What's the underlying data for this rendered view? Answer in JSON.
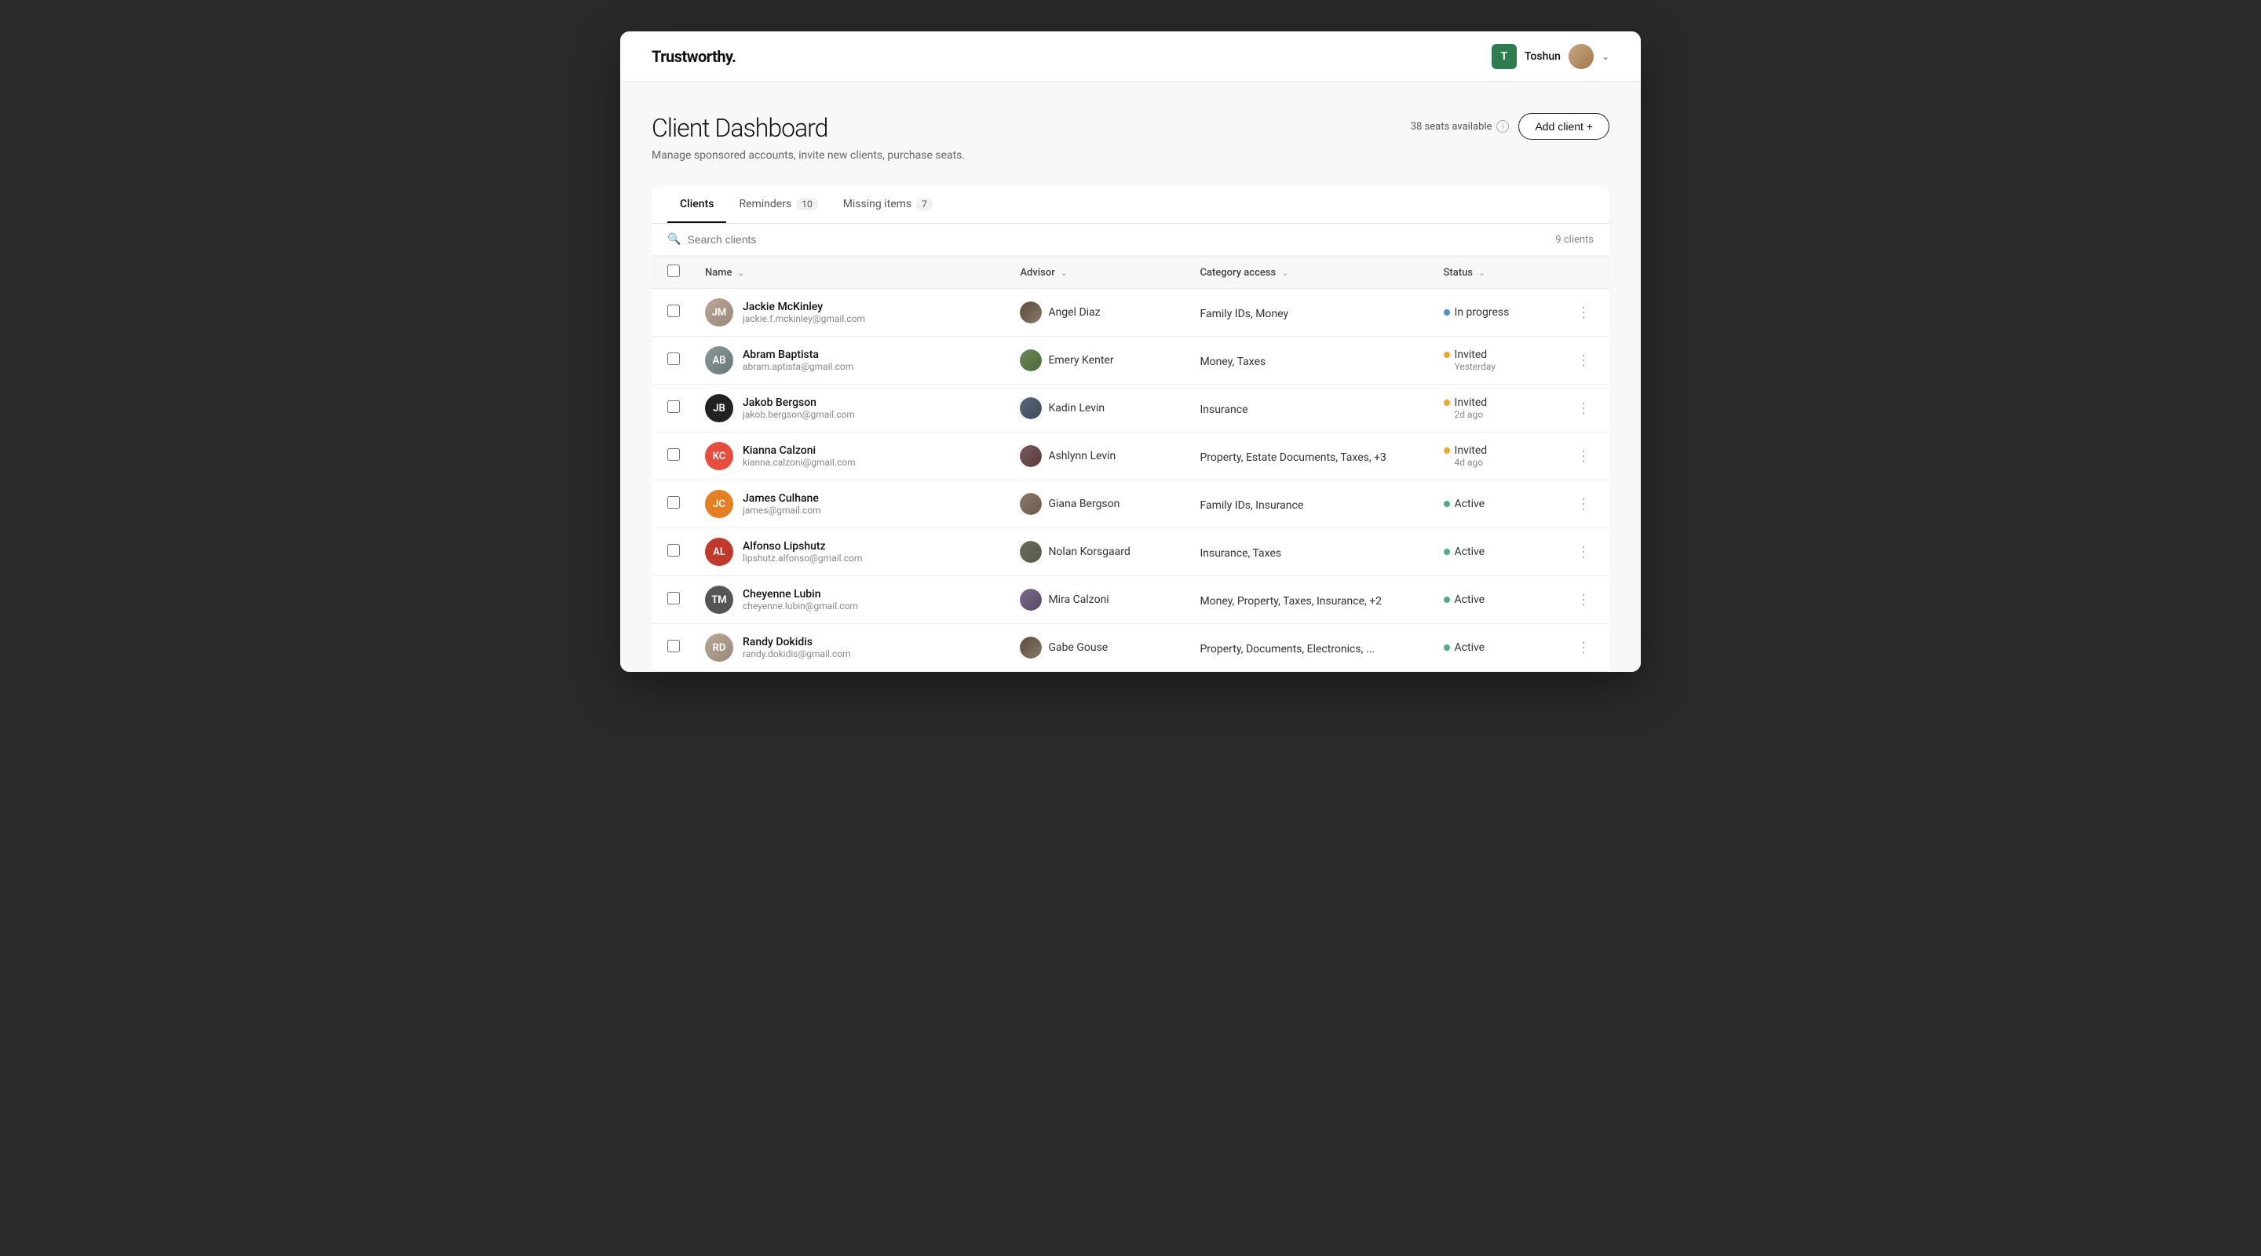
{
  "app": {
    "logo": "Trustworthy."
  },
  "header": {
    "user": {
      "initial": "T",
      "name": "Toshun"
    },
    "seats_available": "38 seats available",
    "add_client_label": "Add client +"
  },
  "page": {
    "title": "Client Dashboard",
    "subtitle": "Manage sponsored accounts, invite new clients, purchase seats."
  },
  "tabs": [
    {
      "id": "clients",
      "label": "Clients",
      "badge": "",
      "active": true
    },
    {
      "id": "reminders",
      "label": "Reminders",
      "badge": "10",
      "active": false
    },
    {
      "id": "missing-items",
      "label": "Missing items",
      "badge": "7",
      "active": false
    }
  ],
  "search": {
    "placeholder": "Search clients",
    "count": "9 clients"
  },
  "table": {
    "columns": [
      {
        "id": "name",
        "label": "Name"
      },
      {
        "id": "advisor",
        "label": "Advisor"
      },
      {
        "id": "category_access",
        "label": "Category access"
      },
      {
        "id": "status",
        "label": "Status"
      }
    ],
    "rows": [
      {
        "id": 1,
        "name": "Jackie McKinley",
        "email": "jackie.f.mckinley@gmail.com",
        "avatar_type": "photo",
        "avatar_color": "client-photo-jackie",
        "avatar_initials": "JM",
        "advisor_name": "Angel Diaz",
        "advisor_avatar": "adv-angel",
        "categories": "Family IDs, Money",
        "status_label": "In progress",
        "status_type": "blue",
        "status_time": ""
      },
      {
        "id": 2,
        "name": "Abram Baptista",
        "email": "abram.aptista@gmail.com",
        "avatar_type": "photo",
        "avatar_color": "client-photo-abram",
        "avatar_initials": "AB",
        "advisor_name": "Emery Kenter",
        "advisor_avatar": "adv-emery",
        "categories": "Money, Taxes",
        "status_label": "Invited",
        "status_type": "yellow",
        "status_time": "Yesterday"
      },
      {
        "id": 3,
        "name": "Jakob Bergson",
        "email": "jakob.bergson@gmail.com",
        "avatar_type": "initials",
        "avatar_color": "avatar-jb",
        "avatar_initials": "JB",
        "advisor_name": "Kadin Levin",
        "advisor_avatar": "adv-kadin",
        "categories": "Insurance",
        "status_label": "Invited",
        "status_type": "yellow",
        "status_time": "2d ago"
      },
      {
        "id": 4,
        "name": "Kianna Calzoni",
        "email": "kianna.calzoni@gmail.com",
        "avatar_type": "initials",
        "avatar_color": "avatar-kc",
        "avatar_initials": "KC",
        "advisor_name": "Ashlynn Levin",
        "advisor_avatar": "adv-ashlynn",
        "categories": "Property, Estate Documents, Taxes, +3",
        "status_label": "Invited",
        "status_type": "yellow",
        "status_time": "4d ago"
      },
      {
        "id": 5,
        "name": "James Culhane",
        "email": "james@gmail.com",
        "avatar_type": "initials",
        "avatar_color": "avatar-jc",
        "avatar_initials": "JC",
        "advisor_name": "Giana Bergson",
        "advisor_avatar": "adv-giana",
        "categories": "Family IDs, Insurance",
        "status_label": "Active",
        "status_type": "green",
        "status_time": ""
      },
      {
        "id": 6,
        "name": "Alfonso Lipshutz",
        "email": "lipshutz.alfonso@gmail.com",
        "avatar_type": "initials",
        "avatar_color": "avatar-al",
        "avatar_initials": "AL",
        "advisor_name": "Nolan Korsgaard",
        "advisor_avatar": "adv-nolan",
        "categories": "Insurance, Taxes",
        "status_label": "Active",
        "status_type": "green",
        "status_time": ""
      },
      {
        "id": 7,
        "name": "Cheyenne Lubin",
        "email": "cheyenne.lubin@gmail.com",
        "avatar_type": "initials",
        "avatar_color": "avatar-tm",
        "avatar_initials": "TM",
        "advisor_name": "Mira Calzoni",
        "advisor_avatar": "adv-mira",
        "categories": "Money, Property, Taxes, Insurance, +2",
        "status_label": "Active",
        "status_type": "green",
        "status_time": ""
      },
      {
        "id": 8,
        "name": "Randy Dokidis",
        "email": "randy.dokidis@gmail.com",
        "avatar_type": "photo",
        "avatar_color": "client-photo-jackie",
        "avatar_initials": "RD",
        "advisor_name": "Gabe Gouse",
        "advisor_avatar": "adv-angel",
        "categories": "Property, Documents, Electronics, ...",
        "status_label": "Active",
        "status_type": "green",
        "status_time": ""
      }
    ]
  }
}
